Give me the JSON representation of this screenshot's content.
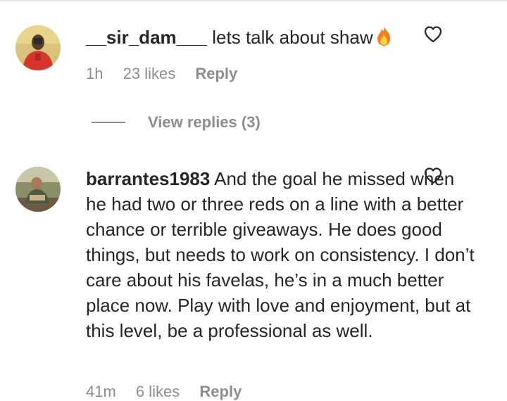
{
  "comments": [
    {
      "username": "__sir_dam___",
      "text": "lets talk about shaw",
      "emoji": "fire-emoji",
      "time": "1h",
      "likes": "23 likes",
      "reply_label": "Reply",
      "view_replies": "View replies (3)"
    },
    {
      "username": "barrantes1983",
      "text": "And the goal he missed when he had two or three reds on a line with a better chance or terrible giveaways. He does good things, but needs to work on consistency. I don’t care about his favelas, he’s in a much better place now. Play with love and enjoyment, but at this level, be a professional as well.",
      "time": "41m",
      "likes": "6 likes",
      "reply_label": "Reply"
    }
  ],
  "colors": {
    "text": "#262626",
    "meta": "#8e8e8e",
    "divider": "#e6e6e6"
  }
}
